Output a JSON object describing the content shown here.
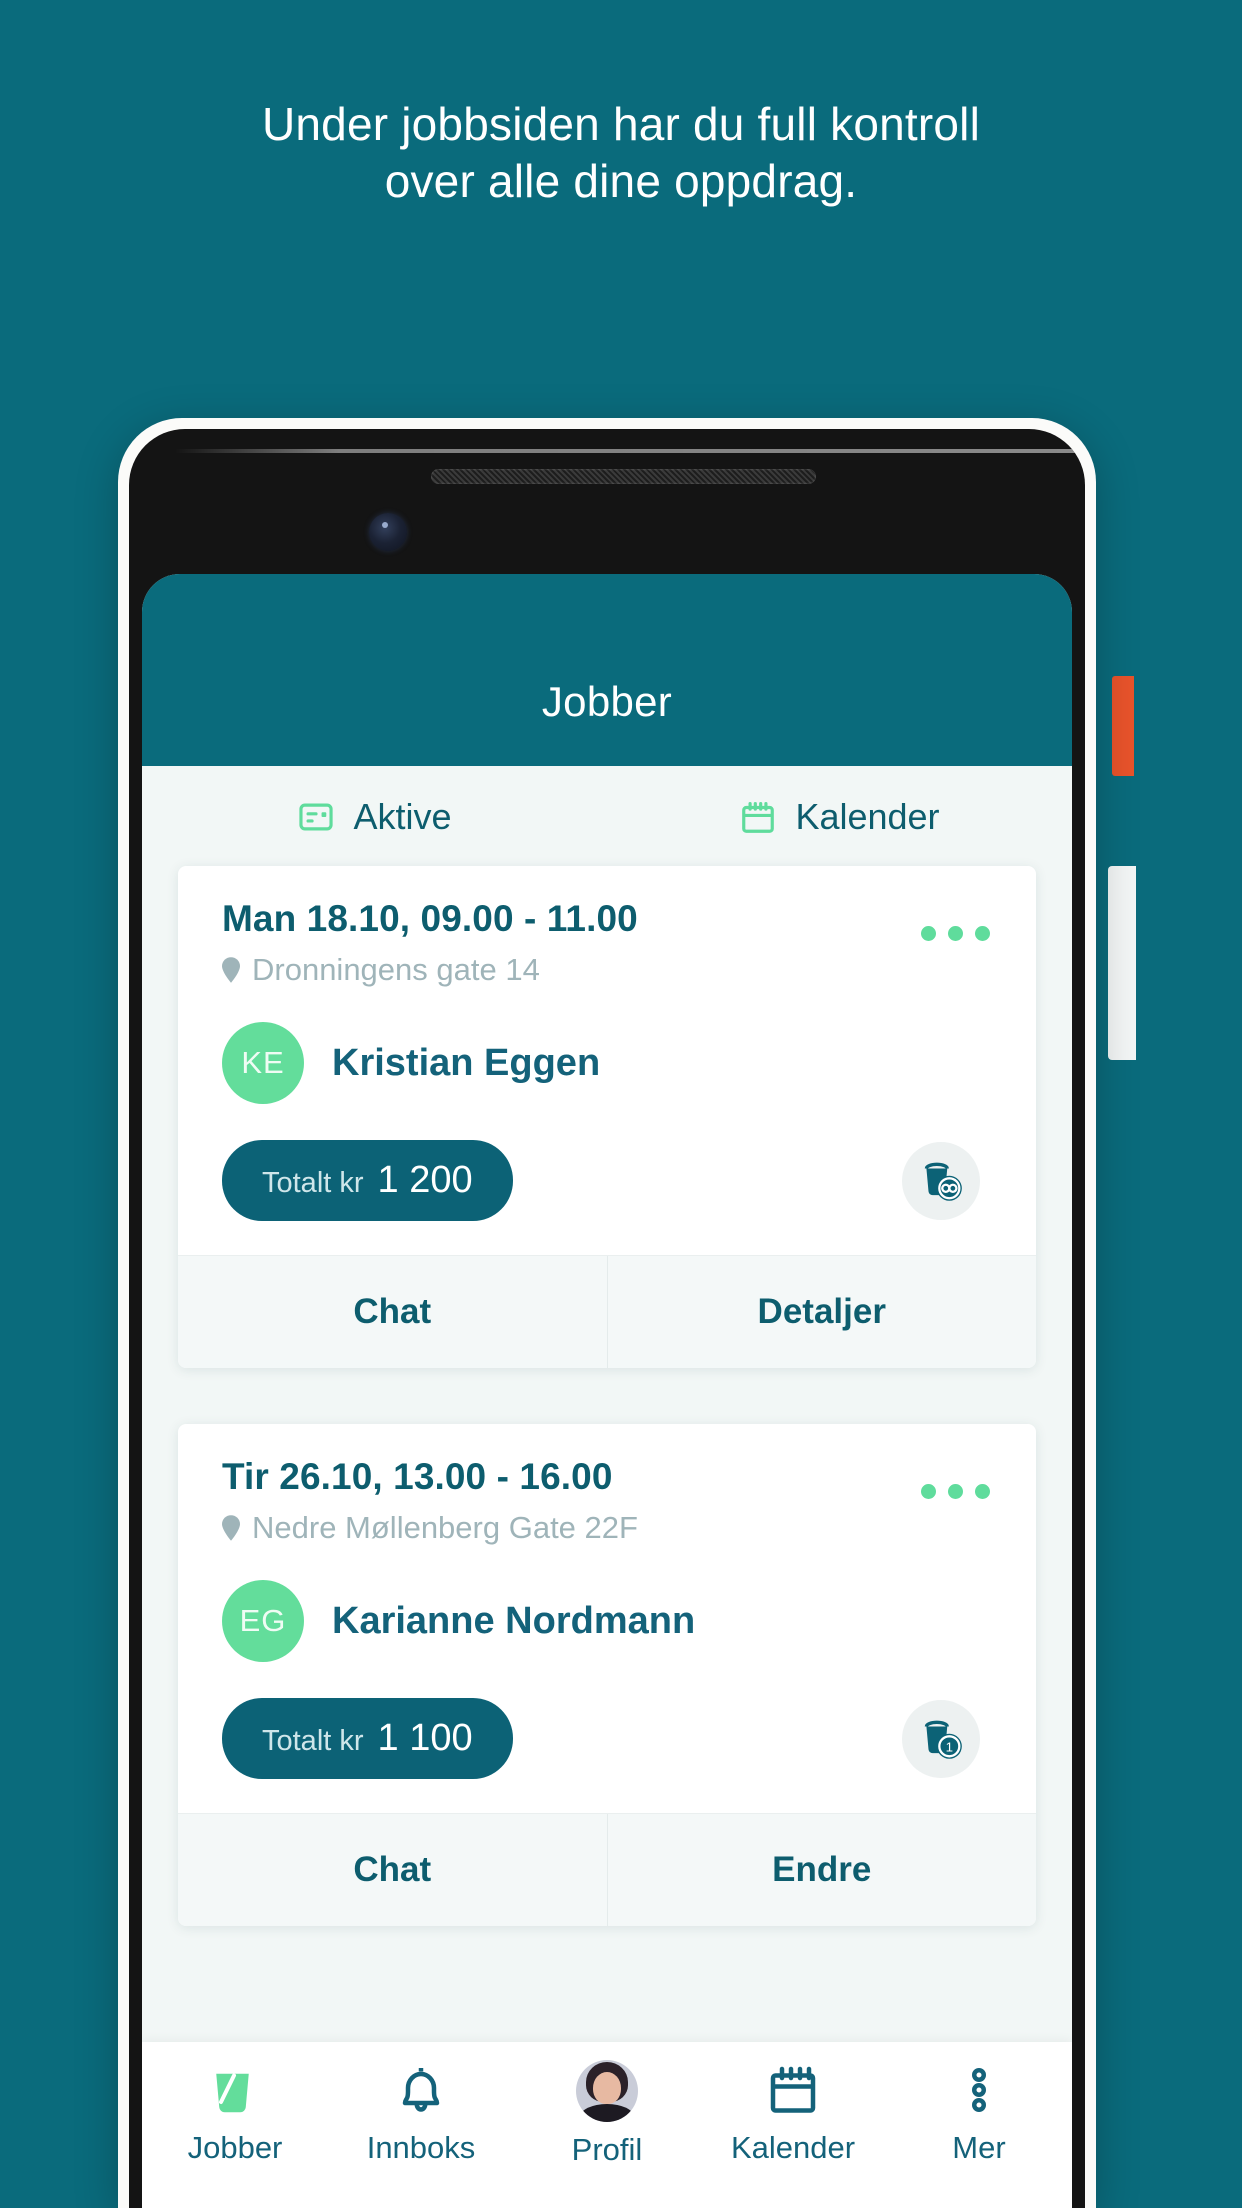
{
  "marketing": {
    "headline_line1": "Under jobbsiden har du full kontroll",
    "headline_line2": "over alle dine oppdrag.",
    "background_color": "#0a6b7c",
    "text_color": "#ffffff"
  },
  "app": {
    "appbar": {
      "title": "Jobber",
      "background": "#0a6b7c"
    },
    "tabs": [
      {
        "label": "Aktive",
        "icon": "list-card-icon"
      },
      {
        "label": "Kalender",
        "icon": "calendar-icon"
      }
    ],
    "accent_green": "#5fdc9c",
    "accent_teal": "#0c6276",
    "jobs": [
      {
        "time": "Man 18.10, 09.00 - 11.00",
        "address": "Dronningens gate 14",
        "initials": "KE",
        "name": "Kristian Eggen",
        "total_label": "Totalt kr",
        "total_value": "1 200",
        "badge": "bucket-infinity-icon",
        "badge_value": "",
        "actions": [
          "Chat",
          "Detaljer"
        ]
      },
      {
        "time": "Tir 26.10, 13.00 - 16.00",
        "address": "Nedre Møllenberg Gate 22F",
        "initials": "EG",
        "name": "Karianne Nordmann",
        "total_label": "Totalt kr",
        "total_value": "1 100",
        "badge": "bucket-count-icon",
        "badge_value": "1",
        "actions": [
          "Chat",
          "Endre"
        ]
      }
    ],
    "bottom_nav": [
      {
        "label": "Jobber",
        "icon": "bucket-icon",
        "active": true
      },
      {
        "label": "Innboks",
        "icon": "bell-icon",
        "active": false
      },
      {
        "label": "Profil",
        "icon": "avatar-photo",
        "active": false
      },
      {
        "label": "Kalender",
        "icon": "calendar-icon",
        "active": false
      },
      {
        "label": "Mer",
        "icon": "more-dots-icon",
        "active": false
      }
    ]
  }
}
